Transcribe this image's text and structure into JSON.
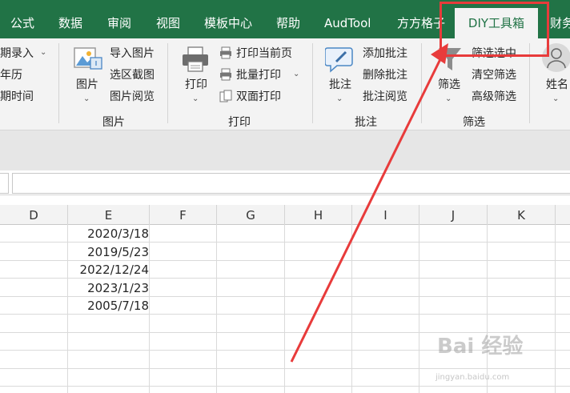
{
  "tabs": [
    {
      "label": "公式"
    },
    {
      "label": "数据"
    },
    {
      "label": "审阅"
    },
    {
      "label": "视图"
    },
    {
      "label": "模板中心"
    },
    {
      "label": "帮助"
    },
    {
      "label": "AudTool"
    },
    {
      "label": "方方格子"
    },
    {
      "label": "DIY工具箱"
    },
    {
      "label": "财务"
    }
  ],
  "ribbon": {
    "left_partial": [
      "期录入",
      "年历",
      "期时间"
    ],
    "picture_group": {
      "main_label": "图片",
      "items": [
        "导入图片",
        "选区截图",
        "图片阅览"
      ],
      "group_label": "图片"
    },
    "print_group": {
      "main_label": "打印",
      "items": [
        "打印当前页",
        "批量打印",
        "双面打印"
      ],
      "group_label": "打印"
    },
    "comment_group": {
      "main_label": "批注",
      "items": [
        "添加批注",
        "删除批注",
        "批注阅览"
      ],
      "group_label": "批注"
    },
    "filter_group": {
      "main_label": "筛选",
      "items": [
        "筛选选中",
        "清空筛选",
        "高级筛选"
      ],
      "group_label": "筛选"
    },
    "name_label": "姓名"
  },
  "columns": [
    "D",
    "E",
    "F",
    "G",
    "H",
    "I",
    "J",
    "K"
  ],
  "dates": [
    "2020/3/18",
    "2019/5/23",
    "2022/12/24",
    "2023/1/23",
    "2005/7/18"
  ],
  "watermark": {
    "main": "Bai 经验",
    "sub": "jingyan.baidu.com"
  },
  "colors": {
    "excel_green": "#217346",
    "highlight_red": "#e83b3b"
  }
}
